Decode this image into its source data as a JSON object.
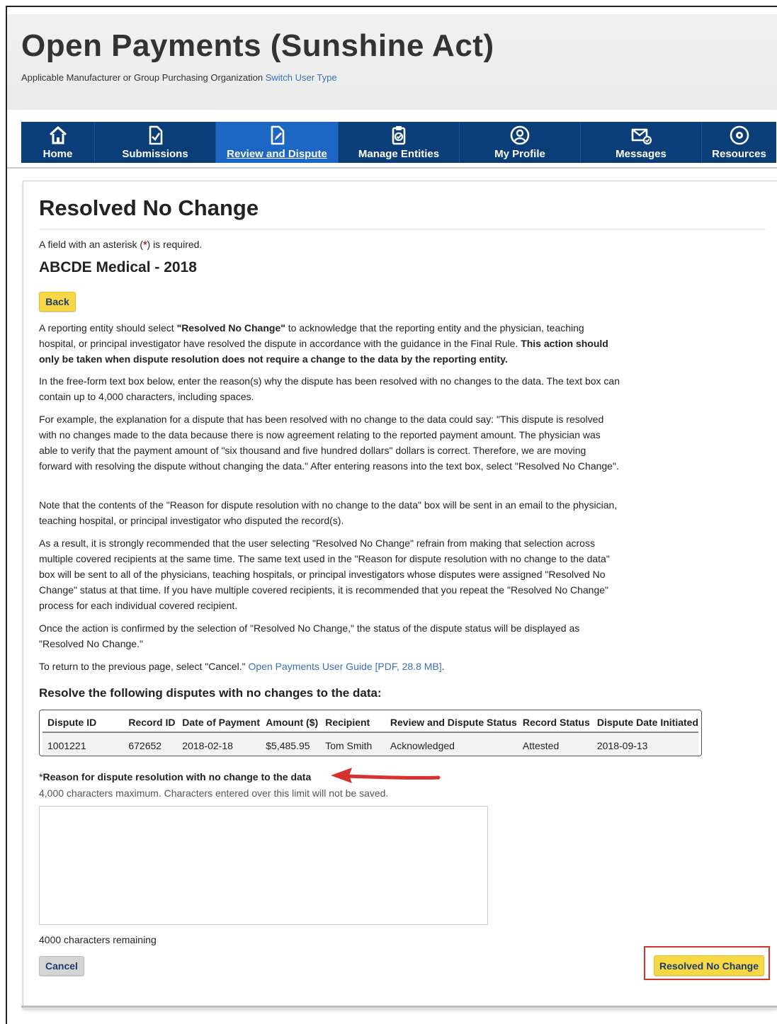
{
  "header": {
    "site_title": "Open Payments (Sunshine Act)",
    "user_type": "Applicable Manufacturer or Group Purchasing Organization",
    "switch_user_link": "Switch User Type"
  },
  "nav": {
    "items": [
      {
        "label": "Home",
        "icon": "home-icon"
      },
      {
        "label": "Submissions",
        "icon": "submissions-icon"
      },
      {
        "label": "Review and Dispute",
        "icon": "review-edit-icon",
        "active": true
      },
      {
        "label": "Manage Entities",
        "icon": "clipboard-icon"
      },
      {
        "label": "My Profile",
        "icon": "profile-icon"
      },
      {
        "label": "Messages",
        "icon": "envelope-icon"
      },
      {
        "label": "Resources",
        "icon": "resources-icon"
      }
    ]
  },
  "page": {
    "title": "Resolved No Change",
    "required_note_pre": "A field with an asterisk (",
    "required_note_ast": "*",
    "required_note_post": ") is required.",
    "entity": "ABCDE Medical - 2018",
    "back_label": "Back",
    "p1_a": "A reporting entity should select ",
    "p1_b": "\"Resolved No Change\"",
    "p1_c": " to acknowledge that the reporting entity and the physician, teaching hospital, or principal investigator have resolved the dispute in accordance with the guidance in the Final Rule. ",
    "p1_d": "This action should only be taken when dispute resolution does not require a change to the data by the reporting entity.",
    "p2": "In the free-form text box below, enter the reason(s) why the dispute has been resolved with no changes to the data. The text box can contain up to 4,000 characters, including spaces.",
    "p3": "For example, the explanation for a dispute that has been resolved with no change to the data could say: \"This dispute is resolved with no changes made to the data because there is now agreement relating to the reported payment amount. The physician was able to verify that the payment amount of \"six thousand and five hundred dollars\" dollars is correct. Therefore, we are moving forward with resolving the dispute without changing the data.\" After entering reasons into the text box, select \"Resolved No Change\".",
    "p4": "Note that the contents of the \"Reason for dispute resolution with no change to the data\" box will be sent in an email to the physician, teaching hospital, or principal investigator who disputed the record(s).",
    "p5": "As a result, it is strongly recommended that the user selecting \"Resolved No Change\" refrain from making that selection across multiple covered recipients at the same time. The same text used in the \"Reason for dispute resolution with no change to the data\" box will be sent to all of the physicians, teaching hospitals, or principal investigators whose disputes were assigned \"Resolved No Change\" status at that time. If you have multiple covered recipients, it is recommended that you repeat the \"Resolved No Change\" process for each individual covered recipient.",
    "p6": "Once the action is confirmed by the selection of \"Resolved No Change,\" the status of the dispute status will be displayed as \"Resolved No Change.\"",
    "p7": "To return to the previous page, select \"Cancel.\" ",
    "guide_link": "Open Payments User Guide [PDF, 28.8 MB]",
    "p7_end": ".",
    "section_title": "Resolve the following disputes with no changes to the data:",
    "table": {
      "headers": [
        "Dispute ID",
        "Record ID",
        "Date of Payment",
        "Amount ($)",
        "Recipient",
        "Review and Dispute Status",
        "Record Status",
        "Dispute Date Initiated"
      ],
      "rows": [
        [
          "1001221",
          "672652",
          "2018-02-18",
          "$5,485.95",
          "Tom Smith",
          "Acknowledged",
          "Attested",
          "2018-09-13"
        ]
      ]
    },
    "reason_asterisk": "*",
    "reason_label": "Reason for dispute resolution with no change to the data",
    "reason_hint": "4,000 characters maximum. Characters entered over this limit will not be saved.",
    "reason_value": "",
    "remaining": "4000 characters remaining",
    "cancel_label": "Cancel",
    "resolve_label": "Resolved No Change"
  },
  "colors": {
    "nav_bg": "#0b3e78",
    "nav_active": "#1c67c4",
    "button_yellow": "#f6d845",
    "annotation_red": "#d7312f"
  }
}
